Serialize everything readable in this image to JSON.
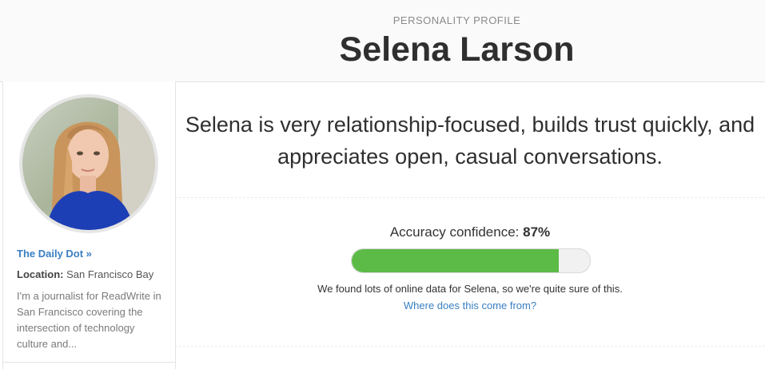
{
  "header": {
    "eyebrow": "PERSONALITY PROFILE",
    "name": "Selena Larson"
  },
  "sidebar": {
    "avatar_icon": "profile-photo",
    "source_link": "The Daily Dot »",
    "location_label": "Location:",
    "location_value": "San Francisco Bay",
    "bio": "I'm a journalist for ReadWrite in San Francisco covering the intersection of technology culture and..."
  },
  "main": {
    "summary": "Selena is very relationship-focused, builds trust quickly, and appreciates open, casual conversations.",
    "confidence_label": "Accuracy confidence:",
    "confidence_value": "87%",
    "confidence_fraction": 0.87,
    "found_note": "We found lots of online data for Selena, so we're quite sure of this.",
    "where_link": "Where does this come from?"
  },
  "colors": {
    "bar_fill": "#5cba47",
    "link": "#3a7fc1"
  }
}
